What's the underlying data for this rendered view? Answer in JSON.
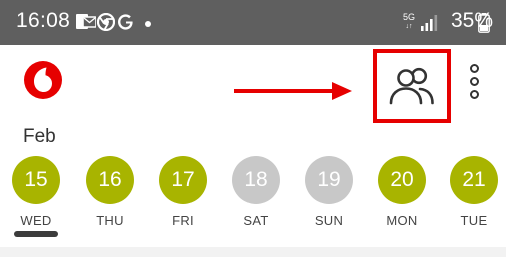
{
  "status_bar": {
    "time": "16:08",
    "network_label": "5G",
    "network_sub": "↓↑",
    "battery": "35%",
    "icons": [
      "mail-icon",
      "chrome-icon",
      "google-icon",
      "dot-icon",
      "signal-icon",
      "battery-icon"
    ]
  },
  "header": {
    "logo": "vodafone-logo",
    "people_button_icon": "people-icon",
    "menu_icon": "overflow-menu-icon"
  },
  "annotation": {
    "color": "#e60000"
  },
  "calendar": {
    "month": "Feb",
    "days": [
      {
        "num": "15",
        "name": "WED",
        "available": true,
        "selected": true
      },
      {
        "num": "16",
        "name": "THU",
        "available": true
      },
      {
        "num": "17",
        "name": "FRI",
        "available": true
      },
      {
        "num": "18",
        "name": "SAT",
        "available": false
      },
      {
        "num": "19",
        "name": "SUN",
        "available": false
      },
      {
        "num": "20",
        "name": "MON",
        "available": true
      },
      {
        "num": "21",
        "name": "TUE",
        "available": true
      }
    ],
    "colors": {
      "available": "#a8b400",
      "unavailable": "#c8c8c8"
    }
  }
}
